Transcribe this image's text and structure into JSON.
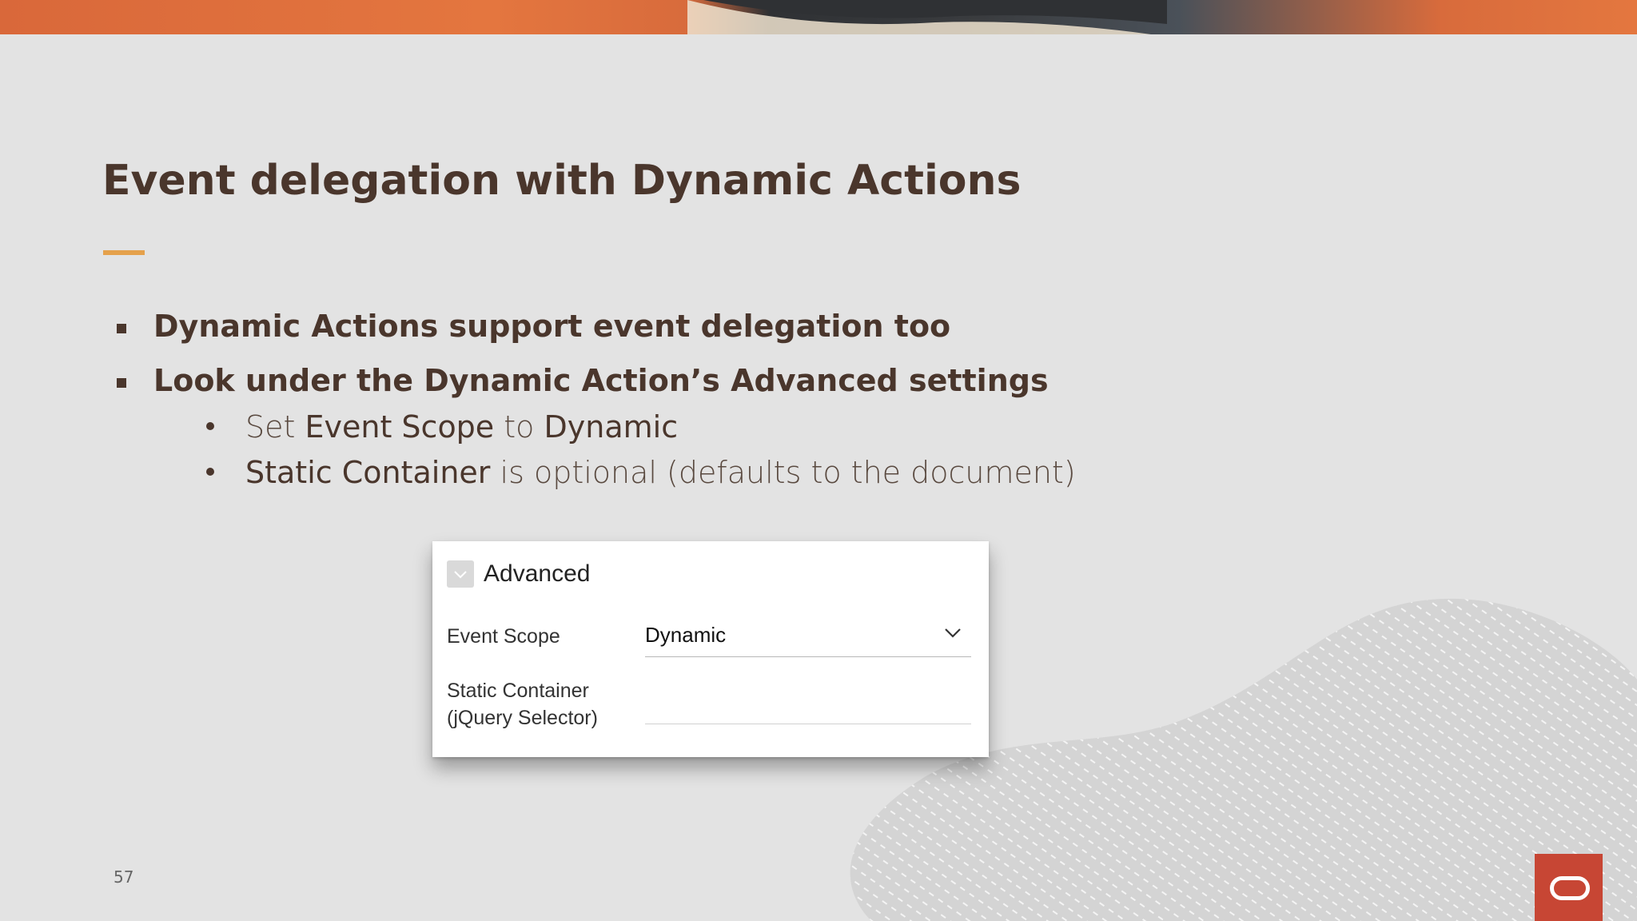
{
  "slide": {
    "title": "Event delegation with Dynamic Actions",
    "bullets": [
      "Dynamic Actions support event delegation too",
      "Look under the Dynamic Action’s Advanced settings"
    ],
    "sub_bullets": [
      {
        "parts": [
          "Set ",
          "Event Scope",
          " to ",
          "Dynamic"
        ]
      },
      {
        "parts": [
          "Static Container",
          " is optional (defaults to the document)"
        ]
      }
    ],
    "page_number": "57"
  },
  "panel": {
    "title": "Advanced",
    "event_scope_label": "Event Scope",
    "event_scope_value": "Dynamic",
    "static_container_label_line1": "Static Container",
    "static_container_label_line2": "(jQuery Selector)",
    "static_container_value": ""
  },
  "colors": {
    "background": "#e3e3e3",
    "title_text": "#4a362c",
    "accent_rule": "#e5a14b",
    "banner_orange": "#d9683a",
    "oracle_red": "#c74634"
  },
  "icons": [
    "collapse-toggle-icon",
    "chevron-down-icon",
    "oracle-logo-icon"
  ]
}
